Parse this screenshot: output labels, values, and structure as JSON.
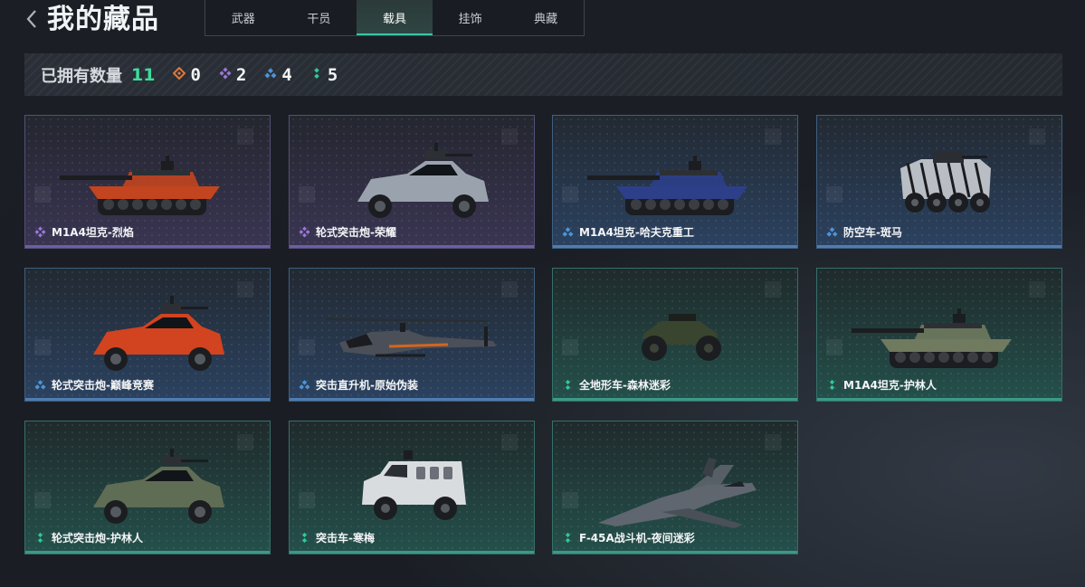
{
  "header": {
    "title": "我的藏品",
    "tabs": [
      {
        "label": "武器",
        "active": false
      },
      {
        "label": "干员",
        "active": false
      },
      {
        "label": "载具",
        "active": true
      },
      {
        "label": "挂饰",
        "active": false
      },
      {
        "label": "典藏",
        "active": false
      }
    ]
  },
  "stats": {
    "label": "已拥有数量",
    "total": "11",
    "counts": [
      {
        "rarity": "orange",
        "value": "0"
      },
      {
        "rarity": "purple",
        "value": "2"
      },
      {
        "rarity": "blue",
        "value": "4"
      },
      {
        "rarity": "green",
        "value": "5"
      }
    ]
  },
  "colors": {
    "orange": "#e07a3a",
    "purple": "#9a78d8",
    "blue": "#4e93d6",
    "green": "#33c79a",
    "accent": "#3ddc9c"
  },
  "items": [
    {
      "name": "M1A4坦克-烈焰",
      "rarity": "purple",
      "vehicle": "tank",
      "color": "#c2451f"
    },
    {
      "name": "轮式突击炮-荣耀",
      "rarity": "purple",
      "vehicle": "buggy",
      "color": "#9aa3ad"
    },
    {
      "name": "M1A4坦克-哈夫克重工",
      "rarity": "blue",
      "vehicle": "tank",
      "color": "#2e3f8a"
    },
    {
      "name": "防空车-斑马",
      "rarity": "blue",
      "vehicle": "apc",
      "color": "#b9bec4"
    },
    {
      "name": "轮式突击炮-巅峰竞赛",
      "rarity": "blue",
      "vehicle": "buggy",
      "color": "#d2431f"
    },
    {
      "name": "突击直升机-原始伪装",
      "rarity": "blue",
      "vehicle": "heli",
      "color": "#4b5058"
    },
    {
      "name": "全地形车-森林迷彩",
      "rarity": "green",
      "vehicle": "atv",
      "color": "#3a4530"
    },
    {
      "name": "M1A4坦克-护林人",
      "rarity": "green",
      "vehicle": "tank",
      "color": "#6f7a5e"
    },
    {
      "name": "轮式突击炮-护林人",
      "rarity": "green",
      "vehicle": "buggy",
      "color": "#5f6d55"
    },
    {
      "name": "突击车-寒梅",
      "rarity": "green",
      "vehicle": "truck",
      "color": "#d9dcdf"
    },
    {
      "name": "F-45A战斗机-夜间迷彩",
      "rarity": "green",
      "vehicle": "jet",
      "color": "#5f666f"
    }
  ]
}
